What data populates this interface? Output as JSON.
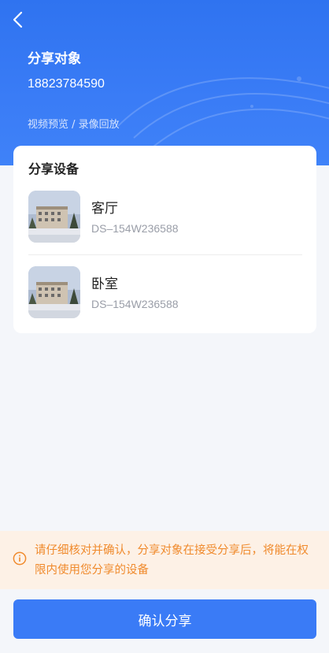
{
  "header": {
    "title": "分享对象",
    "phone": "18823784590",
    "permissions": "视频预览 / 录像回放"
  },
  "devices": {
    "section_title": "分享设备",
    "items": [
      {
        "name": "客厅",
        "id": "DS–154W236588"
      },
      {
        "name": "卧室",
        "id": "DS–154W236588"
      }
    ]
  },
  "notice": {
    "text": "请仔细核对并确认，分享对象在接受分享后，将能在权限内使用您分享的设备"
  },
  "footer": {
    "confirm_label": "确认分享"
  },
  "colors": {
    "primary": "#3a7bf6",
    "notice_bg": "#fdf1e6",
    "notice_text": "#f08a2c",
    "page_bg": "#f4f6fa"
  },
  "icons": {
    "back": "chevron-left-icon",
    "notice": "info-icon"
  }
}
